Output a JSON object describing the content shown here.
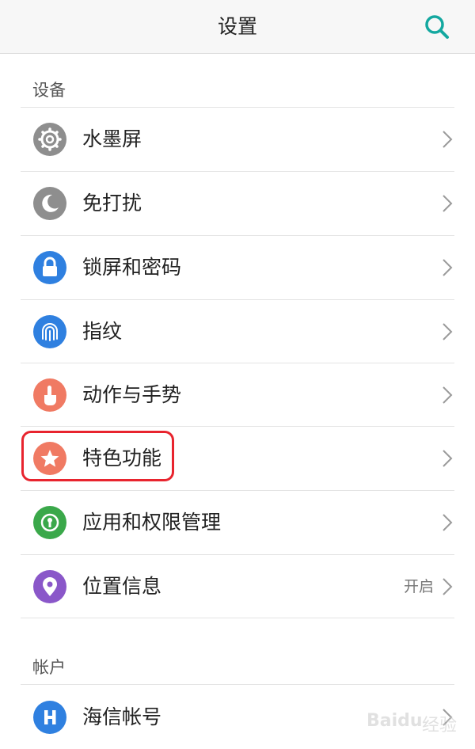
{
  "header": {
    "title": "设置",
    "search_icon": "search-icon"
  },
  "sections": [
    {
      "title": "设备"
    },
    {
      "title": "帐户"
    }
  ],
  "items": [
    {
      "label": "水墨屏",
      "icon": "gear-icon",
      "color": "#8e8e8e",
      "value": ""
    },
    {
      "label": "免打扰",
      "icon": "moon-icon",
      "color": "#8e8e8e",
      "value": ""
    },
    {
      "label": "锁屏和密码",
      "icon": "lock-icon",
      "color": "#2f80e0",
      "value": ""
    },
    {
      "label": "指纹",
      "icon": "fingerprint-icon",
      "color": "#2f80e0",
      "value": ""
    },
    {
      "label": "动作与手势",
      "icon": "hand-gesture-icon",
      "color": "#f07a63",
      "value": ""
    },
    {
      "label": "特色功能",
      "icon": "star-icon",
      "color": "#f07a63",
      "value": ""
    },
    {
      "label": "应用和权限管理",
      "icon": "app-permission-icon",
      "color": "#3aa84a",
      "value": ""
    },
    {
      "label": "位置信息",
      "icon": "location-icon",
      "color": "#8a57c9",
      "value": "开启"
    },
    {
      "label": "海信帐号",
      "icon": "hisense-h-icon",
      "color": "#2f80e0",
      "value": ""
    }
  ],
  "watermark": {
    "brand": "Baidu",
    "sub": "经验"
  },
  "colors": {
    "accent": "#14a8a0",
    "highlight": "#e8242e"
  }
}
